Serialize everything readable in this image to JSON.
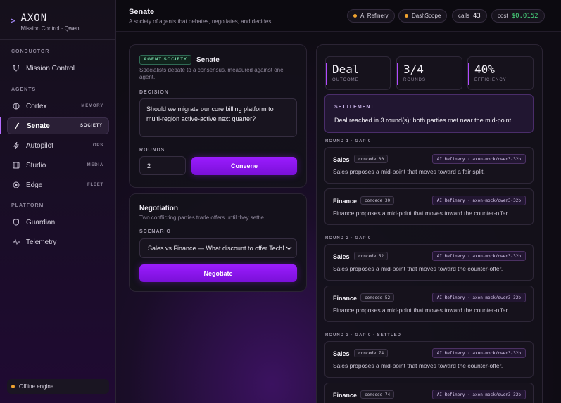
{
  "brand": {
    "title": "AXON",
    "subtitle": "Mission Control · Qwen"
  },
  "sidebar": {
    "conductor_label": "CONDUCTOR",
    "mission_control": "Mission Control",
    "agents_label": "AGENTS",
    "agents": [
      {
        "label": "Cortex",
        "tag": "MEMORY",
        "icon": "brain-icon"
      },
      {
        "label": "Senate",
        "tag": "SOCIETY",
        "icon": "gavel-icon"
      },
      {
        "label": "Autopilot",
        "tag": "OPS",
        "icon": "bolt-icon"
      },
      {
        "label": "Studio",
        "tag": "MEDIA",
        "icon": "film-icon"
      },
      {
        "label": "Edge",
        "tag": "FLEET",
        "icon": "edge-icon"
      }
    ],
    "platform_label": "PLATFORM",
    "platform": [
      {
        "label": "Guardian",
        "icon": "shield-icon"
      },
      {
        "label": "Telemetry",
        "icon": "pulse-icon"
      }
    ],
    "engine_status": "Offline engine"
  },
  "header": {
    "title": "Senate",
    "subtitle": "A society of agents that debates, negotiates, and decides.",
    "provider1": "AI Refinery",
    "provider2": "DashScope",
    "calls_label": "calls",
    "calls_value": "43",
    "cost_label": "cost",
    "cost_value": "$0.0152"
  },
  "society": {
    "badge": "AGENT SOCIETY",
    "title": "Senate",
    "desc": "Specialists debate to a consensus, measured against one agent.",
    "decision_label": "DECISION",
    "decision_value": "Should we migrate our core billing platform to multi-region active-active next quarter?",
    "rounds_label": "ROUNDS",
    "rounds_value": "2",
    "convene_label": "Convene"
  },
  "negotiation": {
    "title": "Negotiation",
    "desc": "Two conflicting parties trade offers until they settle.",
    "scenario_label": "SCENARIO",
    "scenario_value": "Sales vs Finance — What discount to offer TechNova",
    "negotiate_label": "Negotiate"
  },
  "results": {
    "stats": [
      {
        "value": "Deal",
        "label": "OUTCOME"
      },
      {
        "value": "3/4",
        "label": "ROUNDS"
      },
      {
        "value": "40%",
        "label": "EFFICIENCY"
      }
    ],
    "settlement_label": "SETTLEMENT",
    "settlement_text": "Deal reached in 3 round(s): both parties met near the mid-point.",
    "rounds": [
      {
        "label": "ROUND 1 · GAP 0",
        "messages": [
          {
            "who": "Sales",
            "tag": "concede 30",
            "model": "AI Refinery · axon-mock/qwen3-32b",
            "body": "Sales proposes a mid-point that moves toward a fair split."
          },
          {
            "who": "Finance",
            "tag": "concede 30",
            "model": "AI Refinery · axon-mock/qwen3-32b",
            "body": "Finance proposes a mid-point that moves toward the counter-offer."
          }
        ]
      },
      {
        "label": "ROUND 2 · GAP 0",
        "messages": [
          {
            "who": "Sales",
            "tag": "concede 52",
            "model": "AI Refinery · axon-mock/qwen3-32b",
            "body": "Sales proposes a mid-point that moves toward the counter-offer."
          },
          {
            "who": "Finance",
            "tag": "concede 52",
            "model": "AI Refinery · axon-mock/qwen3-32b",
            "body": "Finance proposes a mid-point that moves toward the counter-offer."
          }
        ]
      },
      {
        "label": "ROUND 3 · GAP 0 · SETTLED",
        "messages": [
          {
            "who": "Sales",
            "tag": "concede 74",
            "model": "AI Refinery · axon-mock/qwen3-32b",
            "body": "Sales proposes a mid-point that moves toward the counter-offer."
          },
          {
            "who": "Finance",
            "tag": "concede 74",
            "model": "AI Refinery · axon-mock/qwen3-32b",
            "body": ""
          }
        ]
      }
    ]
  },
  "colors": {
    "accent": "#9b1cff",
    "positive": "#4ade80",
    "warning": "#f0a330"
  }
}
